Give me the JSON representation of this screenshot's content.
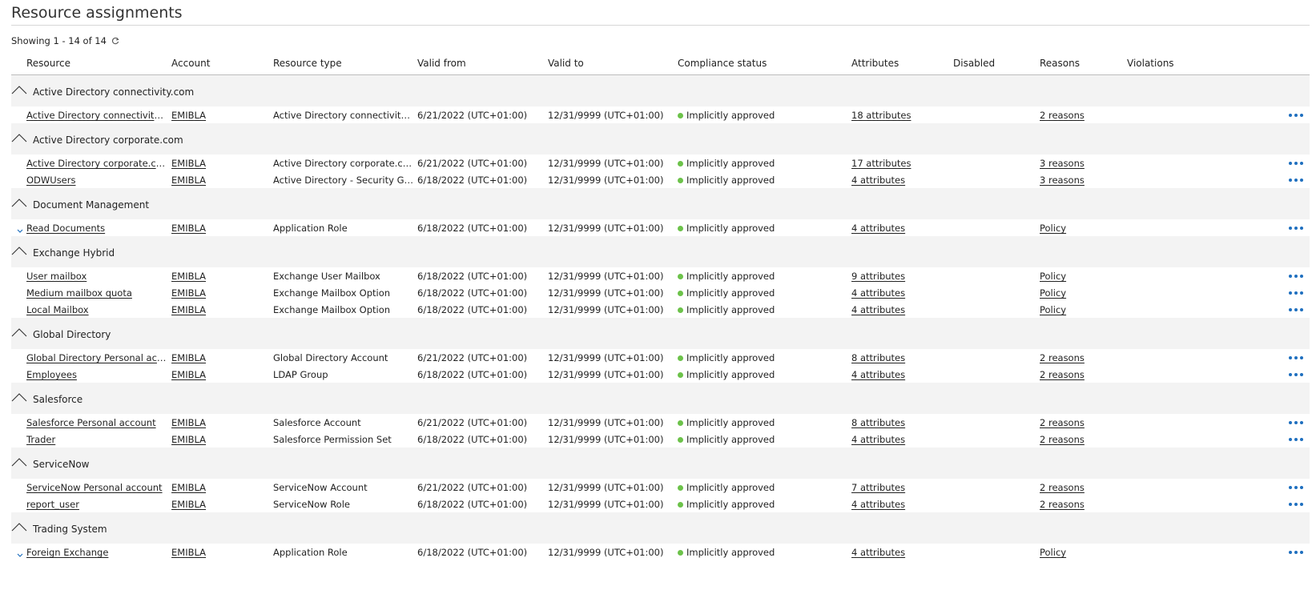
{
  "page": {
    "title": "Resource assignments",
    "showing": "Showing 1 - 14 of 14",
    "refresh_icon": "refresh-icon",
    "more_icon": "more-horizontal-icon"
  },
  "colors": {
    "status_approved": "#6cc24a",
    "accent": "#1f6fbf",
    "group_background": "#f3f3f3"
  },
  "columns": [
    {
      "key": "resource",
      "label": "Resource"
    },
    {
      "key": "account",
      "label": "Account"
    },
    {
      "key": "resource_type",
      "label": "Resource type"
    },
    {
      "key": "valid_from",
      "label": "Valid from"
    },
    {
      "key": "valid_to",
      "label": "Valid to"
    },
    {
      "key": "compliance",
      "label": "Compliance status"
    },
    {
      "key": "attributes",
      "label": "Attributes"
    },
    {
      "key": "disabled",
      "label": "Disabled"
    },
    {
      "key": "reasons",
      "label": "Reasons"
    },
    {
      "key": "violations",
      "label": "Violations"
    }
  ],
  "groups": [
    {
      "name": "Active Directory connectivity.com",
      "rows": [
        {
          "resource": "Active Directory connectivity.com Personal account",
          "account": "EMIBLA",
          "resource_type": "Active Directory connectivity.com Account",
          "valid_from": "6/21/2022 (UTC+01:00)",
          "valid_to": "12/31/9999 (UTC+01:00)",
          "compliance": "Implicitly approved",
          "attributes": "18 attributes",
          "disabled": "",
          "reasons": "2 reasons",
          "reasons_link": true,
          "violations": "",
          "expandable": false
        }
      ]
    },
    {
      "name": "Active Directory corporate.com",
      "rows": [
        {
          "resource": "Active Directory corporate.com Personal account",
          "account": "EMIBLA",
          "resource_type": "Active Directory corporate.com Account",
          "valid_from": "6/21/2022 (UTC+01:00)",
          "valid_to": "12/31/9999 (UTC+01:00)",
          "compliance": "Implicitly approved",
          "attributes": "17 attributes",
          "disabled": "",
          "reasons": "3 reasons",
          "reasons_link": true,
          "violations": "",
          "expandable": false
        },
        {
          "resource": "ODWUsers",
          "account": "EMIBLA",
          "resource_type": "Active Directory - Security Group",
          "valid_from": "6/18/2022 (UTC+01:00)",
          "valid_to": "12/31/9999 (UTC+01:00)",
          "compliance": "Implicitly approved",
          "attributes": "4 attributes",
          "disabled": "",
          "reasons": "3 reasons",
          "reasons_link": true,
          "violations": "",
          "expandable": false
        }
      ]
    },
    {
      "name": "Document Management",
      "rows": [
        {
          "resource": "Read Documents",
          "account": "EMIBLA",
          "resource_type": "Application Role",
          "valid_from": "6/18/2022 (UTC+01:00)",
          "valid_to": "12/31/9999 (UTC+01:00)",
          "compliance": "Implicitly approved",
          "attributes": "4 attributes",
          "disabled": "",
          "reasons": "Policy",
          "reasons_link": true,
          "violations": "",
          "expandable": true
        }
      ]
    },
    {
      "name": "Exchange Hybrid",
      "rows": [
        {
          "resource": "User mailbox",
          "account": "EMIBLA",
          "resource_type": "Exchange User Mailbox",
          "valid_from": "6/18/2022 (UTC+01:00)",
          "valid_to": "12/31/9999 (UTC+01:00)",
          "compliance": "Implicitly approved",
          "attributes": "9 attributes",
          "disabled": "",
          "reasons": "Policy",
          "reasons_link": true,
          "violations": "",
          "expandable": false
        },
        {
          "resource": "Medium mailbox quota",
          "account": "EMIBLA",
          "resource_type": "Exchange Mailbox Option",
          "valid_from": "6/18/2022 (UTC+01:00)",
          "valid_to": "12/31/9999 (UTC+01:00)",
          "compliance": "Implicitly approved",
          "attributes": "4 attributes",
          "disabled": "",
          "reasons": "Policy",
          "reasons_link": true,
          "violations": "",
          "expandable": false
        },
        {
          "resource": "Local Mailbox",
          "account": "EMIBLA",
          "resource_type": "Exchange Mailbox Option",
          "valid_from": "6/18/2022 (UTC+01:00)",
          "valid_to": "12/31/9999 (UTC+01:00)",
          "compliance": "Implicitly approved",
          "attributes": "4 attributes",
          "disabled": "",
          "reasons": "Policy",
          "reasons_link": true,
          "violations": "",
          "expandable": false
        }
      ]
    },
    {
      "name": "Global Directory",
      "rows": [
        {
          "resource": "Global Directory Personal account",
          "account": "EMIBLA",
          "resource_type": "Global Directory Account",
          "valid_from": "6/21/2022 (UTC+01:00)",
          "valid_to": "12/31/9999 (UTC+01:00)",
          "compliance": "Implicitly approved",
          "attributes": "8 attributes",
          "disabled": "",
          "reasons": "2 reasons",
          "reasons_link": true,
          "violations": "",
          "expandable": false
        },
        {
          "resource": "Employees",
          "account": "EMIBLA",
          "resource_type": "LDAP Group",
          "valid_from": "6/18/2022 (UTC+01:00)",
          "valid_to": "12/31/9999 (UTC+01:00)",
          "compliance": "Implicitly approved",
          "attributes": "4 attributes",
          "disabled": "",
          "reasons": "2 reasons",
          "reasons_link": true,
          "violations": "",
          "expandable": false
        }
      ]
    },
    {
      "name": "Salesforce",
      "rows": [
        {
          "resource": "Salesforce Personal account",
          "account": "EMIBLA",
          "resource_type": "Salesforce Account",
          "valid_from": "6/21/2022 (UTC+01:00)",
          "valid_to": "12/31/9999 (UTC+01:00)",
          "compliance": "Implicitly approved",
          "attributes": "8 attributes",
          "disabled": "",
          "reasons": "2 reasons",
          "reasons_link": true,
          "violations": "",
          "expandable": false
        },
        {
          "resource": "Trader",
          "account": "EMIBLA",
          "resource_type": "Salesforce Permission Set",
          "valid_from": "6/18/2022 (UTC+01:00)",
          "valid_to": "12/31/9999 (UTC+01:00)",
          "compliance": "Implicitly approved",
          "attributes": "4 attributes",
          "disabled": "",
          "reasons": "2 reasons",
          "reasons_link": true,
          "violations": "",
          "expandable": false
        }
      ]
    },
    {
      "name": "ServiceNow",
      "rows": [
        {
          "resource": "ServiceNow Personal account",
          "account": "EMIBLA",
          "resource_type": "ServiceNow Account",
          "valid_from": "6/21/2022 (UTC+01:00)",
          "valid_to": "12/31/9999 (UTC+01:00)",
          "compliance": "Implicitly approved",
          "attributes": "7 attributes",
          "disabled": "",
          "reasons": "2 reasons",
          "reasons_link": true,
          "violations": "",
          "expandable": false
        },
        {
          "resource": "report_user",
          "account": "EMIBLA",
          "resource_type": "ServiceNow Role",
          "valid_from": "6/18/2022 (UTC+01:00)",
          "valid_to": "12/31/9999 (UTC+01:00)",
          "compliance": "Implicitly approved",
          "attributes": "4 attributes",
          "disabled": "",
          "reasons": "2 reasons",
          "reasons_link": true,
          "violations": "",
          "expandable": false
        }
      ]
    },
    {
      "name": "Trading System",
      "rows": [
        {
          "resource": "Foreign Exchange",
          "account": "EMIBLA",
          "resource_type": "Application Role",
          "valid_from": "6/18/2022 (UTC+01:00)",
          "valid_to": "12/31/9999 (UTC+01:00)",
          "compliance": "Implicitly approved",
          "attributes": "4 attributes",
          "disabled": "",
          "reasons": "Policy",
          "reasons_link": true,
          "violations": "",
          "expandable": true
        }
      ]
    }
  ]
}
